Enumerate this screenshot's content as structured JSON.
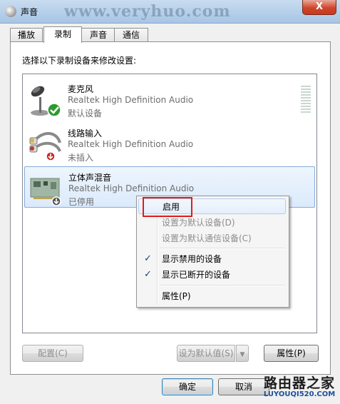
{
  "window": {
    "title": "声音",
    "watermark": "www.veryhuo.com",
    "close_glyph": "X"
  },
  "tabs": [
    {
      "label": "播放",
      "active": false
    },
    {
      "label": "录制",
      "active": true
    },
    {
      "label": "声音",
      "active": false
    },
    {
      "label": "通信",
      "active": false
    }
  ],
  "instruction": "选择以下录制设备来修改设置:",
  "devices": [
    {
      "name": "麦克风",
      "driver": "Realtek High Definition Audio",
      "status": "默认设备",
      "icon": "microphone-icon",
      "badge": "green-check"
    },
    {
      "name": "线路输入",
      "driver": "Realtek High Definition Audio",
      "status": "未插入",
      "icon": "rca-cable-icon",
      "badge": "red-down-arrow"
    },
    {
      "name": "立体声混音",
      "driver": "Realtek High Definition Audio",
      "status": "已停用",
      "icon": "sound-card-icon",
      "badge": "gray-down-arrow",
      "selected": true
    }
  ],
  "context_menu": {
    "items": [
      {
        "label": "启用",
        "disabled": false,
        "checked": false,
        "hover": true
      },
      {
        "label": "设置为默认设备(D)",
        "disabled": true,
        "checked": false
      },
      {
        "label": "设置为默认通信设备(C)",
        "disabled": true,
        "checked": false
      },
      {
        "label": "显示禁用的设备",
        "disabled": false,
        "checked": true
      },
      {
        "label": "显示已断开的设备",
        "disabled": false,
        "checked": true
      },
      {
        "label": "属性(P)",
        "disabled": false,
        "checked": false
      }
    ]
  },
  "buttons": {
    "configure": "配置(C)",
    "set_default": "设为默认值(S)",
    "properties": "属性(P)",
    "ok": "确定",
    "cancel": "取消"
  },
  "branding": {
    "name": "路由器之家",
    "url": "LUYOUQI520.COM"
  },
  "colors": {
    "highlight_box": "#e21a1a",
    "check": "#1b3f84",
    "status_ok": "#2e9a2e",
    "status_unplugged": "#c8281e"
  }
}
